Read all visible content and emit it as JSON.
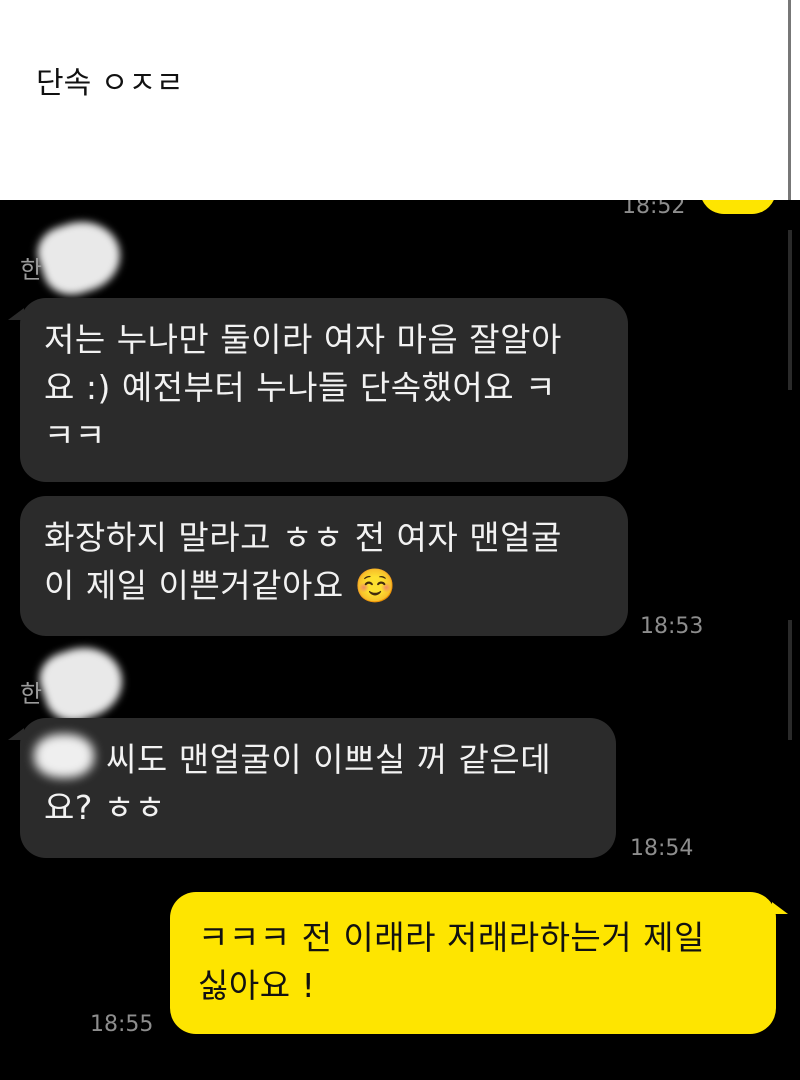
{
  "caption": "단속 ㅇㅈㄹ",
  "chat": {
    "top_time": "18:52",
    "sender_initial": "한",
    "messages": [
      {
        "side": "in",
        "lines": [
          "저는 누나만 둘이라 여자 마음 잘알아",
          "요 :)  예전부터 누나들 단속했어요 ㅋ",
          "ㅋㅋ"
        ]
      },
      {
        "side": "in",
        "lines": [
          "화장하지 말라고 ㅎㅎ 전 여자 맨얼굴",
          "이 제일 이쁜거같아요 ☺️"
        ],
        "time": "18:53"
      },
      {
        "side": "in",
        "lines": [
          "씨도 맨얼굴이 이쁘실 꺼 같은데",
          "요? ㅎㅎ"
        ],
        "time": "18:54"
      },
      {
        "side": "out",
        "lines": [
          "ㅋㅋㅋ 전 이래라 저래라하는거 제일",
          "싫아요 !"
        ],
        "time": "18:55"
      }
    ]
  },
  "colors": {
    "background": "#000000",
    "incoming_bubble": "#2b2b2b",
    "outgoing_bubble": "#fee500",
    "timestamp": "#8d8d8d"
  },
  "icons": [
    "blurred-profile-avatar"
  ]
}
